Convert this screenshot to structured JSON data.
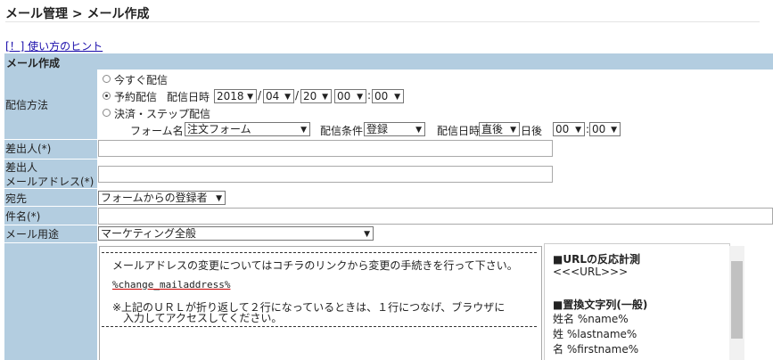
{
  "breadcrumb": "メール管理 > メール作成",
  "hint_link": "[！] 使い方のヒント",
  "section_title": "メール作成",
  "labels": {
    "method": "配信方法",
    "sender": "差出人(*)",
    "sender_mail_1": "差出人",
    "sender_mail_2": "メールアドレス(*)",
    "to": "宛先",
    "subject": "件名(*)",
    "purpose": "メール用途"
  },
  "delivery": {
    "opt_now": "今すぐ配信",
    "opt_scheduled": "予約配信",
    "datetime_label": "配信日時",
    "year": "2018",
    "month": "04",
    "day": "20",
    "hour": "00",
    "minute": "00",
    "opt_step": "決済・ステップ配信",
    "form_label": "フォーム名",
    "form_value": "注文フォーム",
    "cond_label": "配信条件",
    "cond_value": "登録",
    "step_dt_label": "配信日時",
    "step_when": "直後",
    "day_after": "日後",
    "step_hour": "00",
    "step_minute": "00",
    "slash1": "/",
    "slash2": "/",
    "colon": ":",
    "colon2": ":"
  },
  "fields": {
    "to_value": "フォームからの登録者",
    "purpose_value": "マーケティング全般"
  },
  "body": {
    "line1": "メールアドレスの変更についてはコチラのリンクから変更の手続きを行って下さい。",
    "var": "%change_mailaddress%",
    "note1": "※上記のＵＲＬが折り返して２行になっているときは、１行につなげ、ブラウザに",
    "note2": "　入力してアクセスしてください。"
  },
  "side": {
    "url_head": "■URLの反応計測",
    "url_tag": "<<<URL>>>",
    "replace_head": "■置換文字列(一般)",
    "r1": "姓名 %name%",
    "r2": "姓 %lastname%",
    "r3": "名 %firstname%"
  }
}
